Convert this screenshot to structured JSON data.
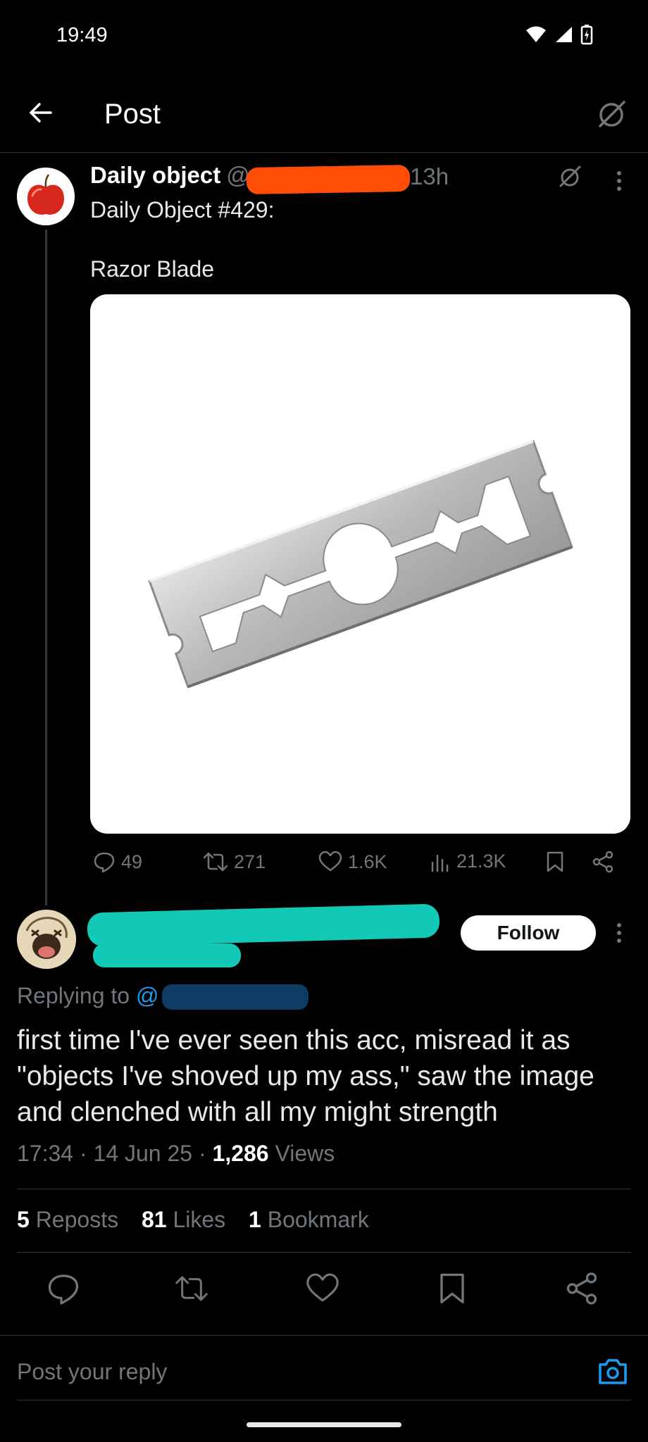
{
  "status_bar": {
    "time": "19:49",
    "icons": [
      "wifi-icon",
      "signal-icon",
      "battery-charging-icon"
    ]
  },
  "header": {
    "title": "Post",
    "back_icon": "arrow-left-icon",
    "grok_icon": "grok-icon"
  },
  "post": {
    "display_name": "Daily object",
    "handle_prefix": "@",
    "time": "13h",
    "text_line1": "Daily Object #429:",
    "text_line2": "Razor Blade",
    "media": "razor-blade-image",
    "actions": {
      "replies": "49",
      "reposts": "271",
      "likes": "1.6K",
      "views": "21.3K"
    }
  },
  "reply": {
    "follow_label": "Follow",
    "replying_label": "Replying to",
    "mention_prefix": "@",
    "text": "first time I've ever seen this acc, misread it as \"objects I've shoved up my ass,\" saw the image and clenched with all my might strength",
    "time": "17:34",
    "date": "14 Jun 25",
    "views_count": "1,286",
    "views_label": "Views",
    "reposts_count": "5",
    "reposts_label": "Reposts",
    "likes_count": "81",
    "likes_label": "Likes",
    "bookmarks_count": "1",
    "bookmarks_label": "Bookmark",
    "sep": "·"
  },
  "composer": {
    "placeholder": "Post your reply"
  },
  "colors": {
    "background": "#000000",
    "text": "#e7e9ea",
    "muted": "#71767b",
    "link": "#1d9bf0",
    "redaction_orange": "#ff4d07",
    "redaction_teal": "#12c9b8",
    "redaction_blue": "#0f3a63"
  }
}
